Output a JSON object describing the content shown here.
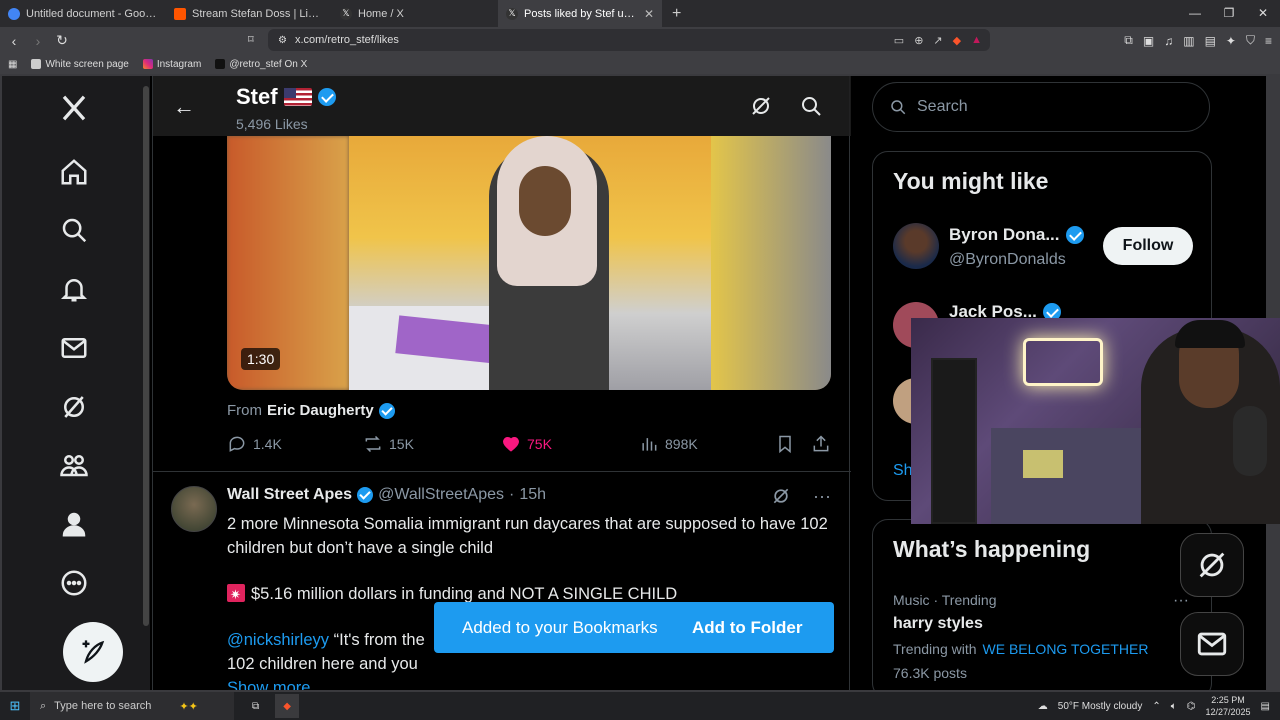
{
  "browser": {
    "tabs": [
      {
        "title": "Untitled document - Google Docs",
        "color": "#4285f4",
        "icon": "docs-icon"
      },
      {
        "title": "Stream Stefan Doss | Listen to Dece",
        "color": "#ff5500",
        "icon": "soundcloud-icon"
      },
      {
        "title": "Home / X",
        "color": "#000000",
        "icon": "x-icon"
      },
      {
        "title": "Posts liked by Stef us (@retro_st",
        "color": "#000000",
        "icon": "x-icon"
      }
    ],
    "url": "x.com/retro_stef/likes",
    "bookmarks": [
      "White screen page",
      "Instagram",
      "@retro_stef On X"
    ]
  },
  "header": {
    "name": "Stef",
    "likes_count": "5,496 Likes"
  },
  "post1": {
    "duration": "1:30",
    "from_label": "From",
    "from_name": "Eric Daugherty",
    "replies": "1.4K",
    "reposts": "15K",
    "likes": "75K",
    "views": "898K"
  },
  "post2": {
    "name": "Wall Street Apes",
    "handle": "@WallStreetApes",
    "dot": "·",
    "time": "15h",
    "line1": "2 more Minnesota Somalia immigrant run daycares that are supposed to have 102 children but don’t have a single child",
    "line2": "$5.16 million dollars in funding and NOT A SINGLE CHILD",
    "mention": "@nickshirleyy",
    "line3_rest": " “It's from the",
    "line4": "102 children here and you",
    "show_more": "Show more"
  },
  "toast": {
    "message": "Added to your Bookmarks",
    "action": "Add to Folder"
  },
  "sidebar_right": {
    "search_placeholder": "Search",
    "wtf_title": "You might like",
    "users": [
      {
        "name": "Byron Dona...",
        "handle": "@ByronDonalds",
        "button": "Follow"
      },
      {
        "name": "Jack Pos..."
      }
    ],
    "show_more": "Sh",
    "happening_title": "What’s happening",
    "trend": {
      "meta": "Music · Trending",
      "name": "harry styles",
      "with_label": "Trending with",
      "with_tag": "WE BELONG TOGETHER",
      "count": "76.3K posts"
    }
  },
  "taskbar": {
    "search_placeholder": "Type here to search",
    "weather": "50°F  Mostly cloudy",
    "time": "2:25 PM",
    "date": "12/27/2025"
  },
  "colors": {
    "accent": "#1d9bf0",
    "like": "#f91880",
    "background": "#000000"
  }
}
